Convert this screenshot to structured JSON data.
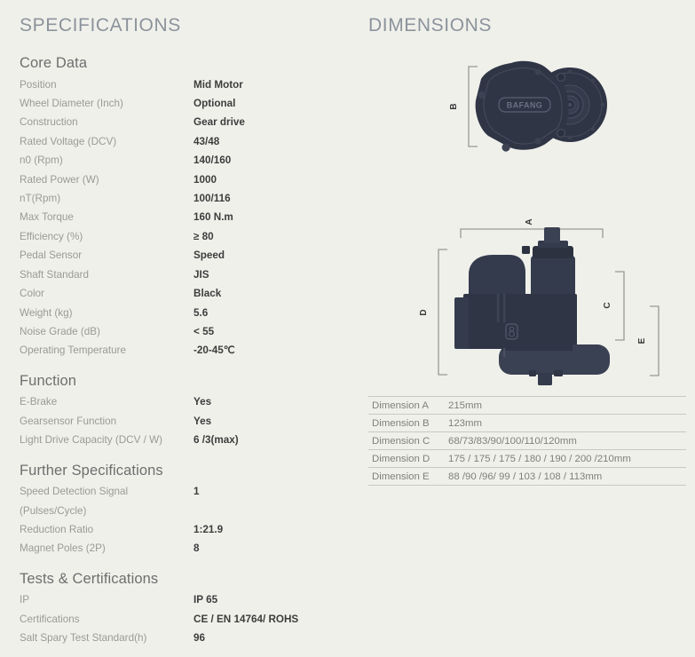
{
  "specifications": {
    "heading": "SPECIFICATIONS",
    "sections": [
      {
        "title": "Core Data",
        "rows": [
          {
            "label": "Position",
            "value": "Mid Motor"
          },
          {
            "label": "Wheel Diameter (Inch)",
            "value": "Optional"
          },
          {
            "label": "Construction",
            "value": "Gear drive"
          },
          {
            "label": "Rated Voltage (DCV)",
            "value": "43/48"
          },
          {
            "label": "n0 (Rpm)",
            "value": "140/160"
          },
          {
            "label": "Rated Power (W)",
            "value": "1000"
          },
          {
            "label": "nT(Rpm)",
            "value": "100/116"
          },
          {
            "label": "Max Torque",
            "value": "160 N.m"
          },
          {
            "label": "Efficiency (%)",
            "value": "≥ 80"
          },
          {
            "label": "Pedal Sensor",
            "value": "Speed"
          },
          {
            "label": "Shaft Standard",
            "value": "JIS"
          },
          {
            "label": "Color",
            "value": "Black"
          },
          {
            "label": "Weight (kg)",
            "value": "5.6"
          },
          {
            "label": "Noise Grade (dB)",
            "value": "< 55"
          },
          {
            "label": "Operating Temperature",
            "value": "-20-45℃"
          }
        ]
      },
      {
        "title": "Function",
        "rows": [
          {
            "label": "E-Brake",
            "value": "Yes"
          },
          {
            "label": "Gearsensor Function",
            "value": "Yes"
          },
          {
            "label": "Light Drive Capacity (DCV / W)",
            "value": "6 /3(max)"
          }
        ]
      },
      {
        "title": "Further Specifications",
        "rows": [
          {
            "label": "Speed Detection Signal",
            "label2": "(Pulses/Cycle)",
            "value": "1"
          },
          {
            "label": "Reduction Ratio",
            "value": "1:21.9"
          },
          {
            "label": "Magnet Poles (2P)",
            "value": "8"
          }
        ]
      },
      {
        "title": "Tests & Certifications",
        "rows": [
          {
            "label": "IP",
            "value": "IP 65"
          },
          {
            "label": "Certifications",
            "value": "CE / EN 14764/ ROHS"
          },
          {
            "label": "Salt Spary Test Standard(h)",
            "value": "96"
          }
        ]
      }
    ]
  },
  "dimensions": {
    "heading": "DIMENSIONS",
    "markers": {
      "a": "A",
      "b": "B",
      "c": "C",
      "d": "D",
      "e": "E"
    },
    "brand_logo_text": "BAFANG",
    "table": [
      {
        "key": "Dimension A",
        "value": "215mm"
      },
      {
        "key": "Dimension B",
        "value": "123mm"
      },
      {
        "key": "Dimension C",
        "value": "68/73/83/90/100/110/120mm"
      },
      {
        "key": "Dimension D",
        "value": "175 / 175 / 175 / 180 / 190 / 200 /210mm"
      },
      {
        "key": "Dimension E",
        "value": "88 /90 /96/ 99 / 103 / 108 / 113mm"
      }
    ]
  },
  "colors": {
    "background": "#f0f0eb",
    "heading": "#8b939b",
    "section_title": "#6e6e6e",
    "label": "#9a9a96",
    "value": "#3d3d3d",
    "motor_body": "#2f3545",
    "motor_dark": "#262b38",
    "bracket": "#9a9a95",
    "table_border": "#c9c9c4"
  }
}
